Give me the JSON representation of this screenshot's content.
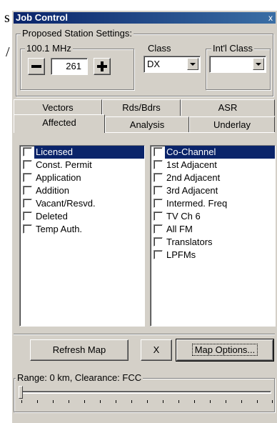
{
  "background_text": [
    "s",
    "/"
  ],
  "window": {
    "title": "Job Control",
    "close_label": "x"
  },
  "proposed": {
    "group_label": "Proposed Station Settings:",
    "freq_label": "100.1 MHz",
    "minus_label": "−",
    "plus_label": "+",
    "channel_value": "261",
    "class_label": "Class",
    "class_value": "DX",
    "intl_class_label": "Int'l Class",
    "intl_class_value": ""
  },
  "tabs": {
    "back_row": [
      "Vectors",
      "Rds/Bdrs",
      "ASR"
    ],
    "front_row": [
      "Affected",
      "Analysis",
      "Underlay"
    ],
    "active": "Affected"
  },
  "left_list": [
    {
      "label": "Licensed",
      "selected": true
    },
    {
      "label": "Const. Permit",
      "selected": false
    },
    {
      "label": "Application",
      "selected": false
    },
    {
      "label": "Addition",
      "selected": false
    },
    {
      "label": "Vacant/Resvd.",
      "selected": false
    },
    {
      "label": "Deleted",
      "selected": false
    },
    {
      "label": "Temp Auth.",
      "selected": false
    }
  ],
  "right_list": [
    {
      "label": "Co-Channel",
      "selected": true
    },
    {
      "label": "1st Adjacent",
      "selected": false
    },
    {
      "label": "2nd Adjacent",
      "selected": false
    },
    {
      "label": "3rd Adjacent",
      "selected": false
    },
    {
      "label": "Intermed. Freq",
      "selected": false
    },
    {
      "label": "TV Ch 6",
      "selected": false
    },
    {
      "label": "All FM",
      "selected": false
    },
    {
      "label": "Translators",
      "selected": false
    },
    {
      "label": "LPFMs",
      "selected": false
    }
  ],
  "buttons": {
    "refresh": "Refresh Map",
    "x": "X",
    "map_options": "Map Options..."
  },
  "range": {
    "label": "Range: 0 km, Clearance: FCC",
    "slider_value": 0
  },
  "colors": {
    "face": "#d4d0c8",
    "selection": "#0a246a",
    "title_start": "#0a246a",
    "title_end": "#3a6ea5"
  }
}
